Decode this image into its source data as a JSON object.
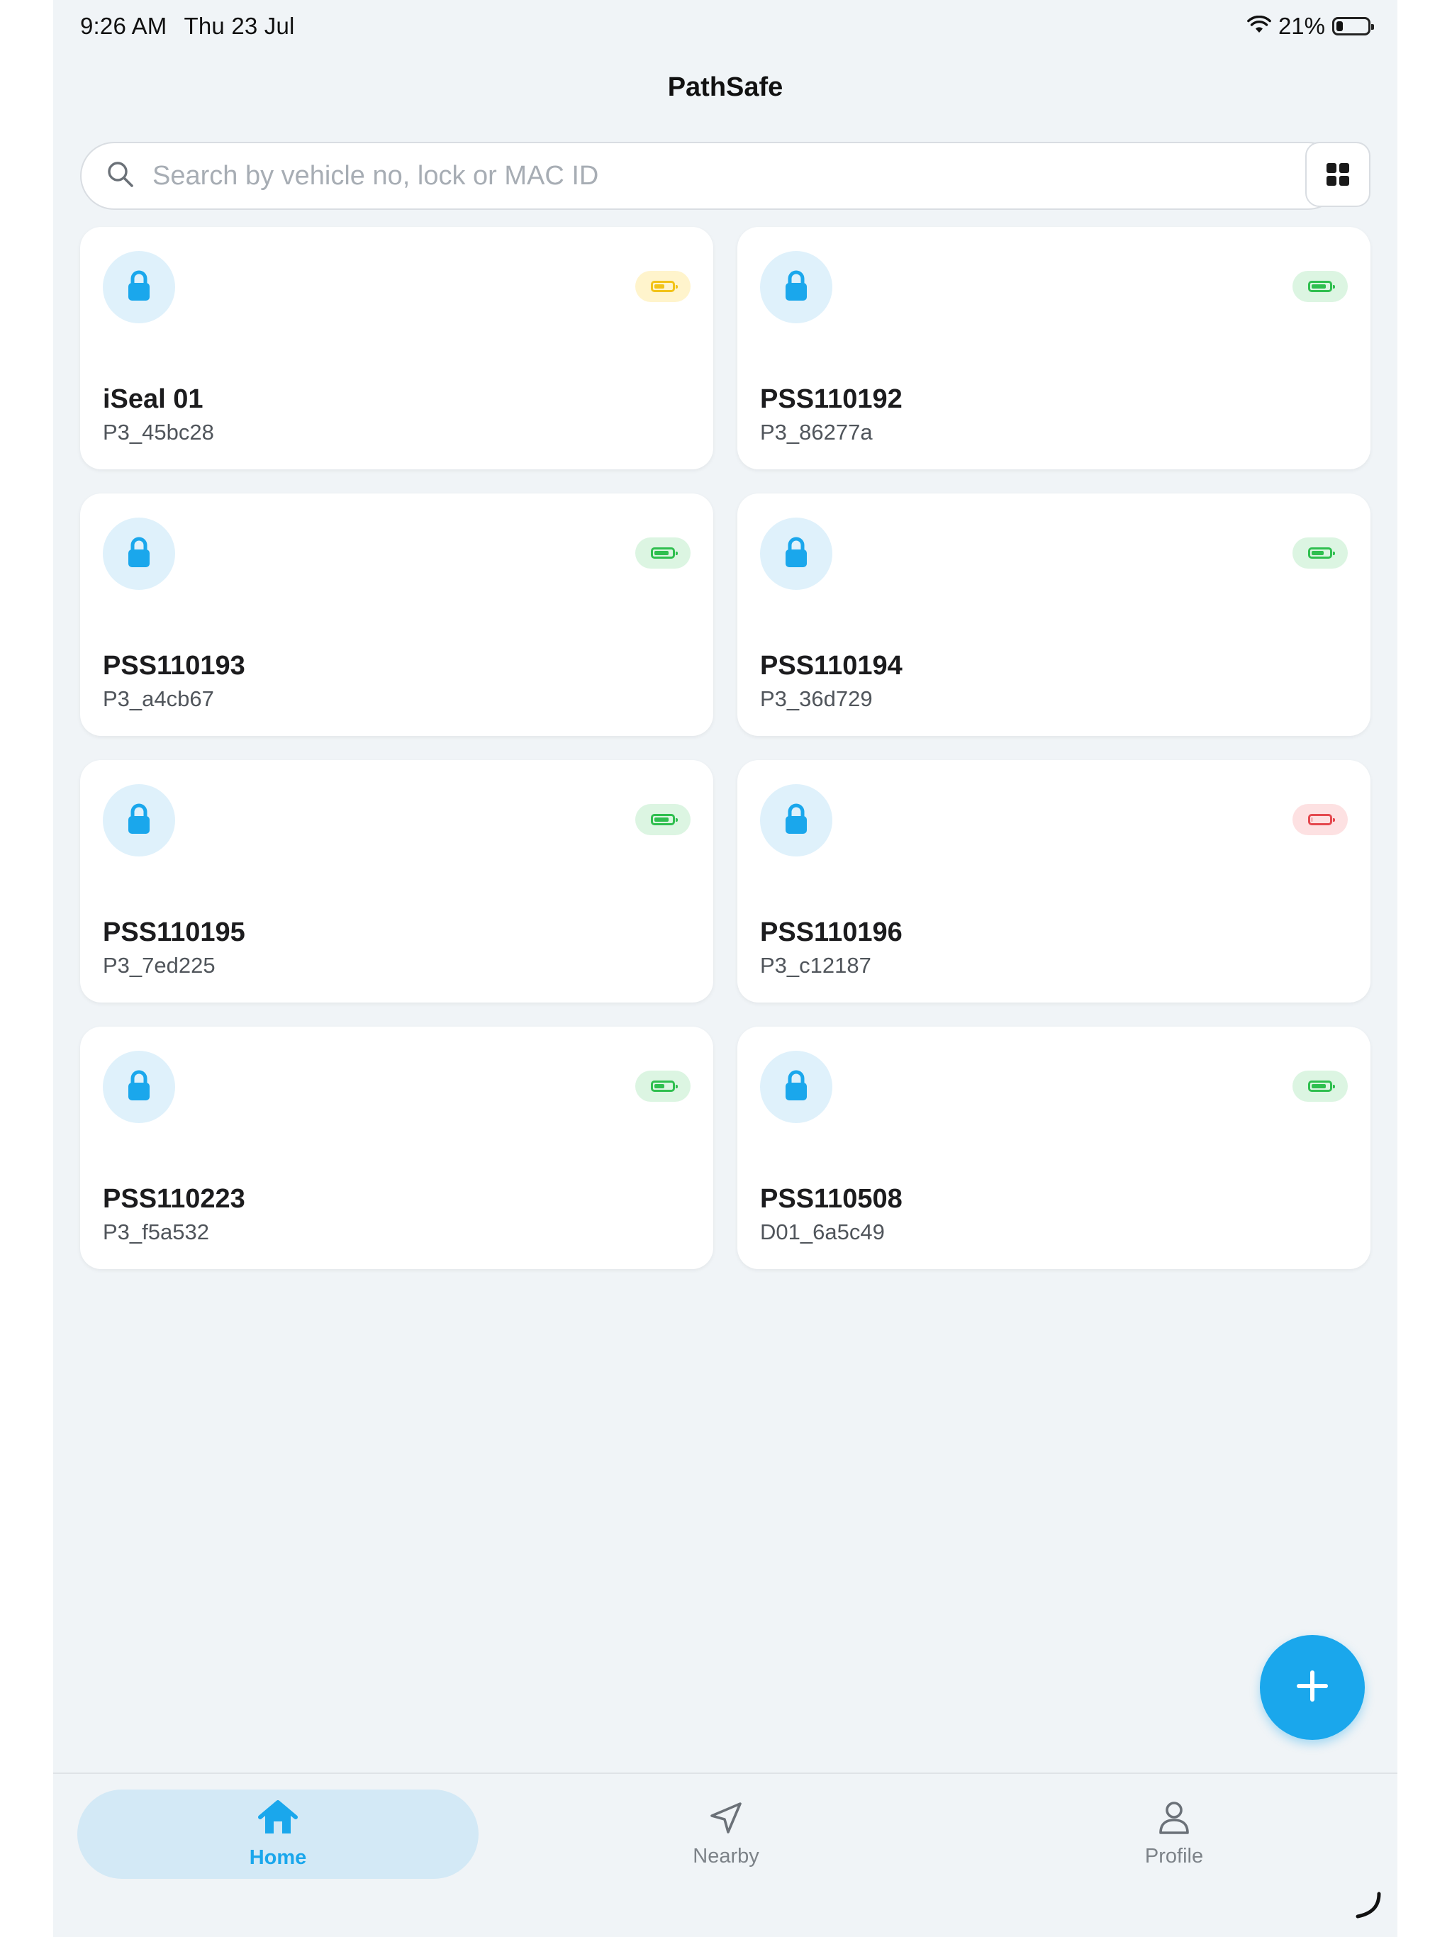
{
  "status_bar": {
    "time": "9:26 AM",
    "date": "Thu 23 Jul",
    "battery_percent": "21%",
    "battery_level": 0.21
  },
  "app": {
    "title": "PathSafe"
  },
  "search": {
    "placeholder": "Search by vehicle no, lock or MAC ID",
    "value": ""
  },
  "toolbar": {
    "view_toggle_icon": "grid-view-icon"
  },
  "colors": {
    "accent": "#1aa7ec",
    "battery_green": "#2fbf4f",
    "battery_yellow": "#f2c318",
    "battery_red": "#e4484e"
  },
  "locks": [
    {
      "name": "iSeal 01",
      "id": "P3_45bc28",
      "battery_status": "medium",
      "battery_level": 0.6
    },
    {
      "name": "PSS110192",
      "id": "P3_86277a",
      "battery_status": "high",
      "battery_level": 0.85
    },
    {
      "name": "PSS110193",
      "id": "P3_a4cb67",
      "battery_status": "high",
      "battery_level": 0.85
    },
    {
      "name": "PSS110194",
      "id": "P3_36d729",
      "battery_status": "high",
      "battery_level": 0.7
    },
    {
      "name": "PSS110195",
      "id": "P3_7ed225",
      "battery_status": "high",
      "battery_level": 0.85
    },
    {
      "name": "PSS110196",
      "id": "P3_c12187",
      "battery_status": "low",
      "battery_level": 0.05
    },
    {
      "name": "PSS110223",
      "id": "P3_f5a532",
      "battery_status": "high",
      "battery_level": 0.6
    },
    {
      "name": "PSS110508",
      "id": "D01_6a5c49",
      "battery_status": "high",
      "battery_level": 0.85
    }
  ],
  "fab": {
    "icon": "plus-icon"
  },
  "bottom_nav": {
    "items": [
      {
        "label": "Home",
        "icon": "home-icon",
        "active": true
      },
      {
        "label": "Nearby",
        "icon": "navigation-arrow-icon",
        "active": false
      },
      {
        "label": "Profile",
        "icon": "person-icon",
        "active": false
      }
    ]
  }
}
